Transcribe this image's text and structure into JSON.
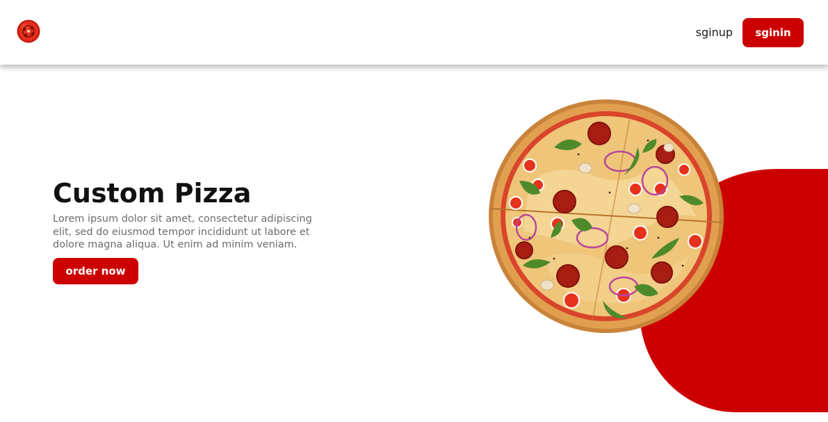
{
  "header": {
    "logo_icon": "tomato-pizza-logo-icon",
    "signup_label": "sginup",
    "signin_label": "sginin"
  },
  "hero": {
    "title": "Custom Pizza",
    "description": "Lorem ipsum dolor sit amet, consectetur adipiscing elit, sed do eiusmod tempor incididunt ut labore et dolore magna aliqua. Ut enim ad minim veniam.",
    "order_label": "order now",
    "image_icon": "pizza-image"
  },
  "colors": {
    "accent": "#cc0000",
    "title_text": "#111111",
    "body_text": "#6b6b6b",
    "background": "#ffffff"
  }
}
